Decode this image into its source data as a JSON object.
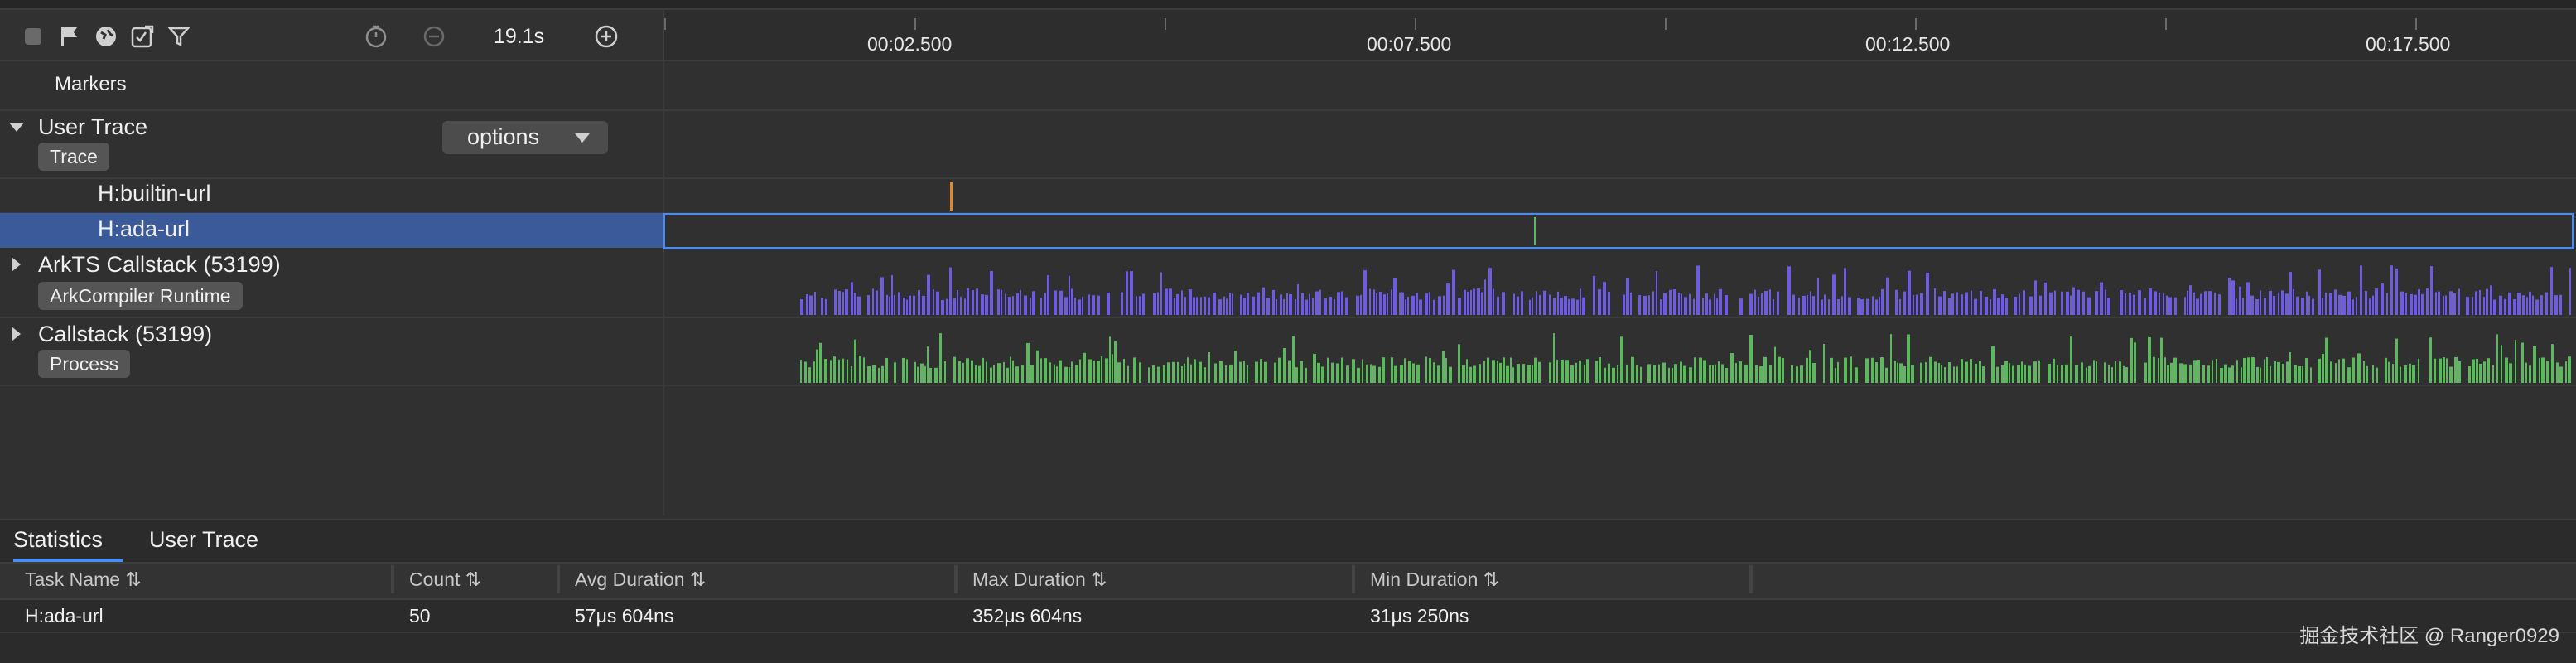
{
  "toolbar": {
    "duration": "19.1s",
    "icons": [
      "stop-icon",
      "flag-icon",
      "globe-icon",
      "trace-icon",
      "filter-icon",
      "timer-icon",
      "zoom-out-icon",
      "zoom-in-icon"
    ]
  },
  "ruler": {
    "labels": [
      "00:02.500",
      "00:07.500",
      "00:12.500",
      "00:17.500"
    ]
  },
  "rows": {
    "markers": "Markers",
    "user_trace": {
      "title": "User Trace",
      "tag": "Trace",
      "options": "options"
    },
    "builtin": "H:builtin-url",
    "ada": "H:ada-url",
    "arkts": {
      "title": "ArkTS Callstack (53199)",
      "tag": "ArkCompiler Runtime"
    },
    "callstack": {
      "title": "Callstack (53199)",
      "tag": "Process"
    }
  },
  "colors": {
    "purple": "#6e5ce0",
    "green": "#5cb85c",
    "marker": "#e0882a",
    "selection": "#4f8ae8"
  },
  "bottom": {
    "tabs": [
      "Statistics",
      "User Trace"
    ],
    "columns": [
      "Task Name ⇅",
      "Count ⇅",
      "Avg Duration ⇅",
      "Max Duration ⇅",
      "Min Duration ⇅"
    ],
    "row": [
      "H:ada-url",
      "50",
      "57μs 604ns",
      "352μs 604ns",
      "31μs 250ns"
    ]
  },
  "watermark": "掘金技术社区 @ Ranger0929"
}
